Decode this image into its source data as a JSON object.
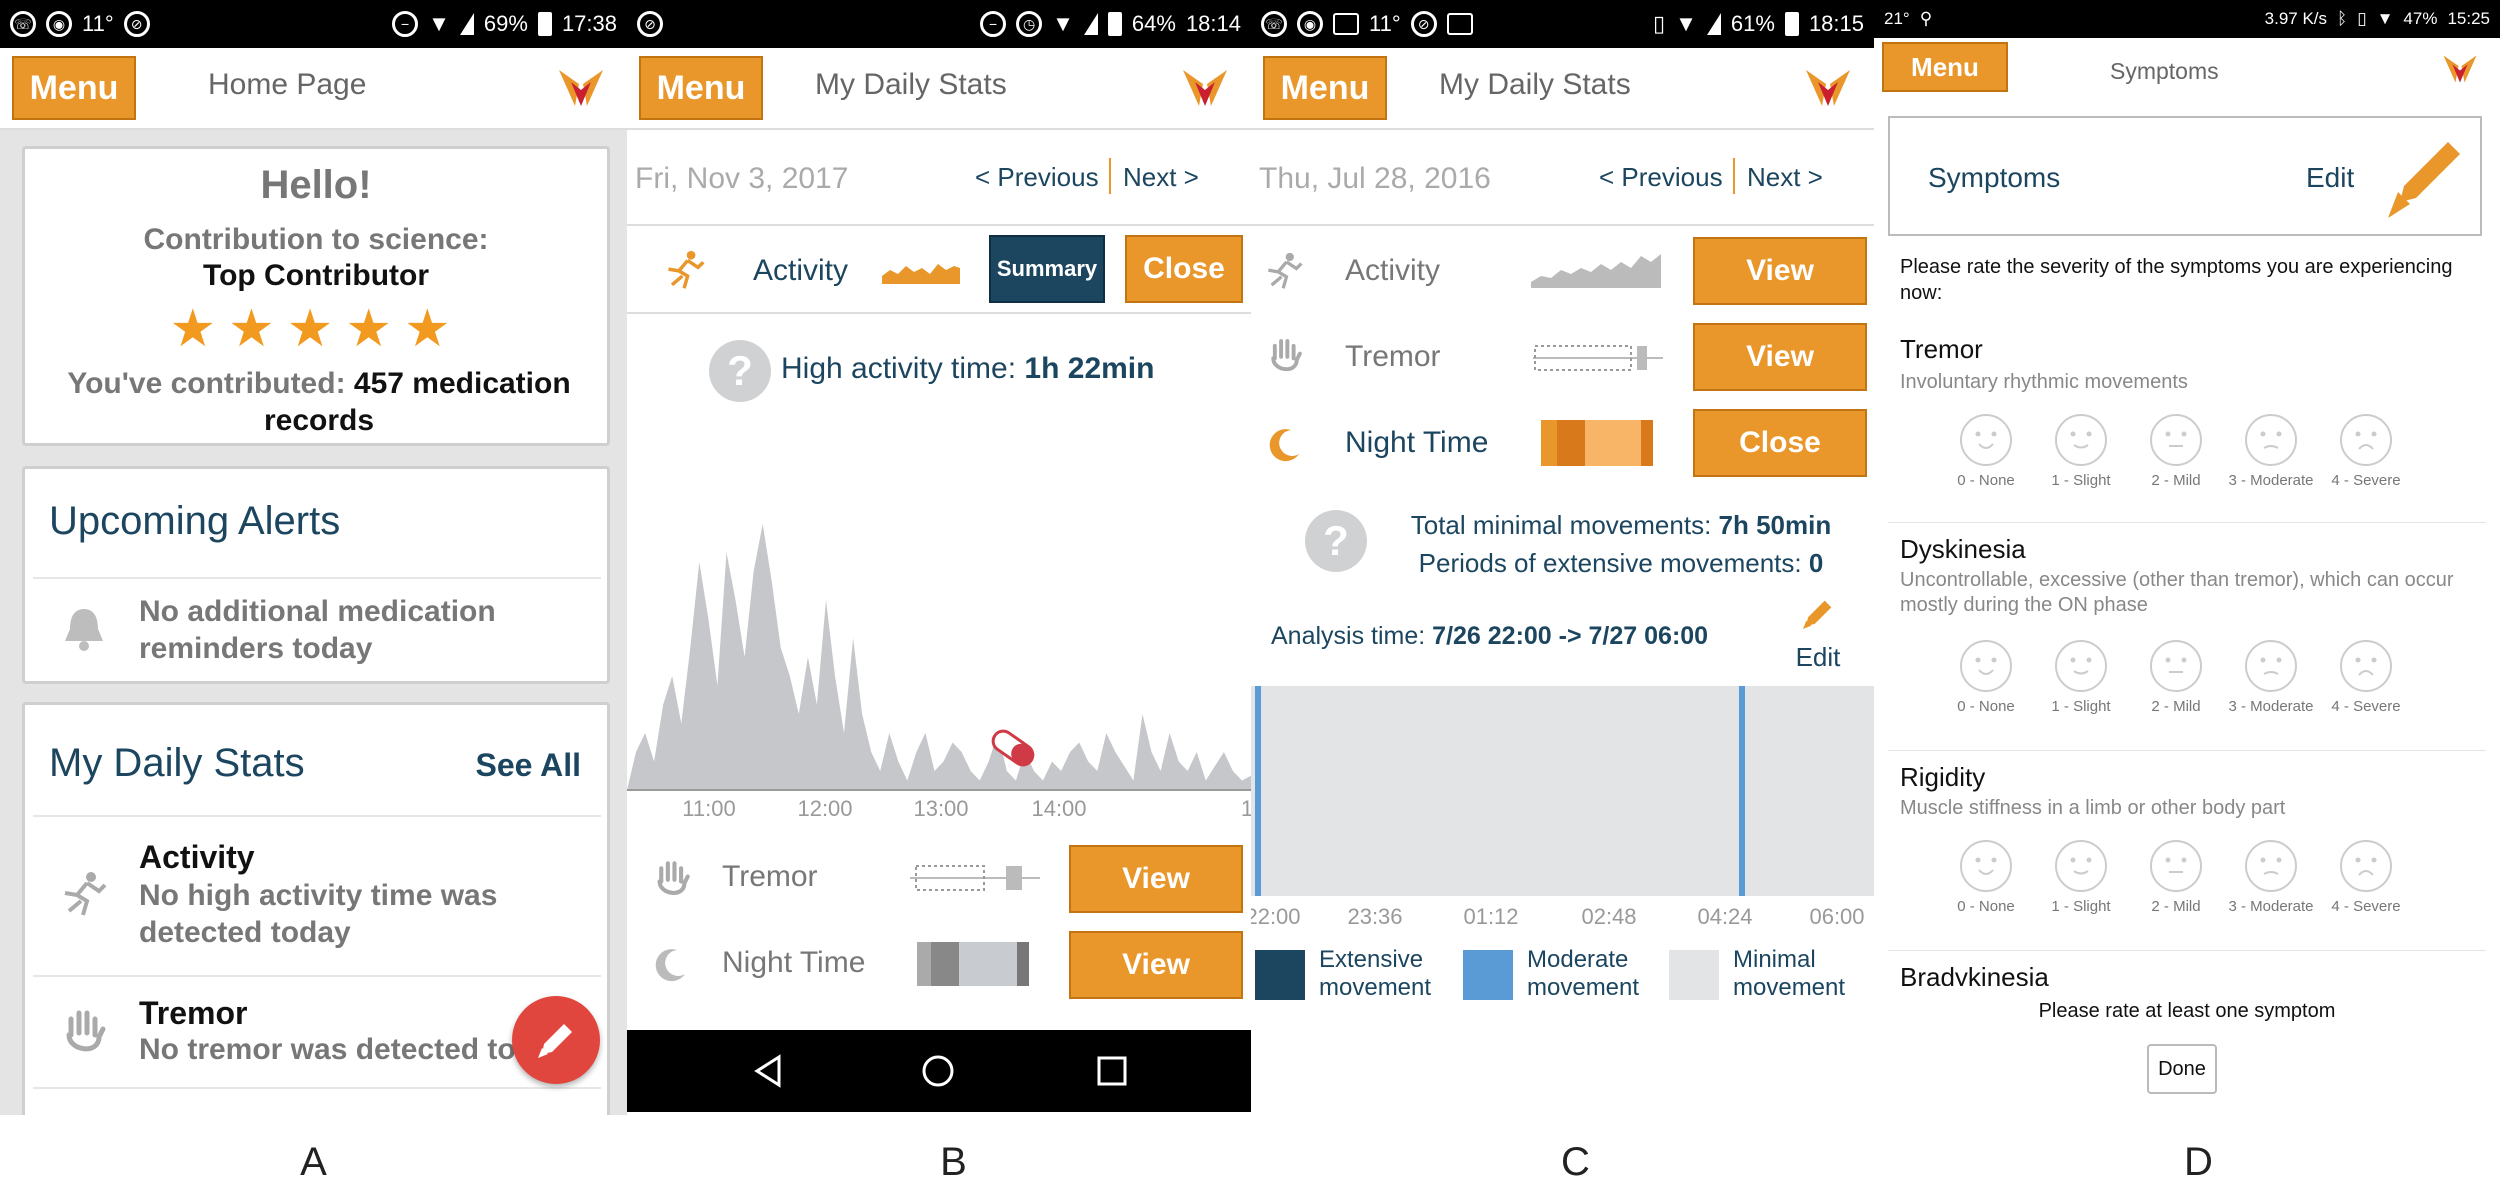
{
  "panel_labels": [
    "A",
    "B",
    "C",
    "D"
  ],
  "colors": {
    "accent": "#e9962a",
    "navy": "#1c4660",
    "chart_gray": "#c5c7ca",
    "pill_red": "#d03a46",
    "fab_red": "#e0463e",
    "moderate_blue": "#5b9bd5",
    "minimal_gray": "#e3e4e6"
  },
  "panelA": {
    "status": {
      "temp": "11°",
      "battery": "69%",
      "time": "17:38"
    },
    "menu": "Menu",
    "title": "Home Page",
    "hello": {
      "greeting": "Hello!",
      "contribution_label": "Contribution to science:",
      "rank": "Top Contributor",
      "stars": 5,
      "contributed_prefix": "You've contributed:",
      "contributed_value": "457 medication records"
    },
    "alerts": {
      "title": "Upcoming Alerts",
      "message": "No additional medication reminders today",
      "icon": "bell-icon"
    },
    "daily": {
      "title": "My Daily Stats",
      "see_all": "See All",
      "items": [
        {
          "title": "Activity",
          "desc": "No high activity time was detected today",
          "icon": "runner-icon"
        },
        {
          "title": "Tremor",
          "desc": "No tremor was detected to",
          "icon": "hand-icon"
        }
      ]
    },
    "fab_icon": "pencil-icon"
  },
  "panelB": {
    "status": {
      "battery": "64%",
      "time": "18:14"
    },
    "menu": "Menu",
    "title": "My Daily Stats",
    "date": "Fri, Nov 3, 2017",
    "prev": "< Previous",
    "next": "Next >",
    "activity": {
      "label": "Activity",
      "summary": "Summary",
      "close": "Close"
    },
    "high_activity_prefix": "High activity time:",
    "high_activity_value": "1h 22min",
    "chart_ticks": [
      "11:00",
      "12:00",
      "13:00",
      "14:00",
      "1"
    ],
    "tremor": {
      "label": "Tremor",
      "button": "View"
    },
    "night": {
      "label": "Night Time",
      "button": "View"
    },
    "nav_icons": [
      "back-icon",
      "home-icon",
      "recents-icon"
    ]
  },
  "panelC": {
    "status": {
      "temp": "11°",
      "battery": "61%",
      "time": "18:15"
    },
    "menu": "Menu",
    "title": "My Daily Stats",
    "date": "Thu, Jul 28, 2016",
    "prev": "< Previous",
    "next": "Next >",
    "activity": {
      "label": "Activity",
      "button": "View"
    },
    "tremor": {
      "label": "Tremor",
      "button": "View"
    },
    "night": {
      "label": "Night Time",
      "button": "Close"
    },
    "total_prefix": "Total minimal movements:",
    "total_value": "7h 50min",
    "periods_prefix": "Periods of extensive movements:",
    "periods_value": "0",
    "analysis_prefix": "Analysis time:",
    "analysis_value": "7/26 22:00 -> 7/27 06:00",
    "edit": "Edit",
    "timeline_ticks": [
      "22:00",
      "23:36",
      "01:12",
      "02:48",
      "04:24",
      "06:00"
    ],
    "legend": [
      {
        "label": "Extensive movement",
        "color": "#1c4660"
      },
      {
        "label": "Moderate movement",
        "color": "#5b9bd5"
      },
      {
        "label": "Minimal movement",
        "color": "#e3e4e6"
      }
    ]
  },
  "panelD": {
    "status": {
      "temp": "21°",
      "speed": "3.97 K/s",
      "battery": "47%",
      "time": "15:25"
    },
    "menu": "Menu",
    "title": "Symptoms",
    "card_title": "Symptoms",
    "card_edit": "Edit",
    "instruction": "Please rate the severity of the symptoms you are experiencing now:",
    "scale": [
      "0 - None",
      "1 - Slight",
      "2 - Mild",
      "3 - Moderate",
      "4 - Severe"
    ],
    "symptoms": [
      {
        "name": "Tremor",
        "desc": "Involuntary rhythmic movements"
      },
      {
        "name": "Dyskinesia",
        "desc": "Uncontrollable, excessive (other than tremor), which can occur mostly during the ON phase"
      },
      {
        "name": "Rigidity",
        "desc": "Muscle stiffness in a limb or other body part"
      },
      {
        "name": "Bradykinesia",
        "desc": ""
      }
    ],
    "footer_msg": "Please rate at least one symptom",
    "done": "Done"
  }
}
